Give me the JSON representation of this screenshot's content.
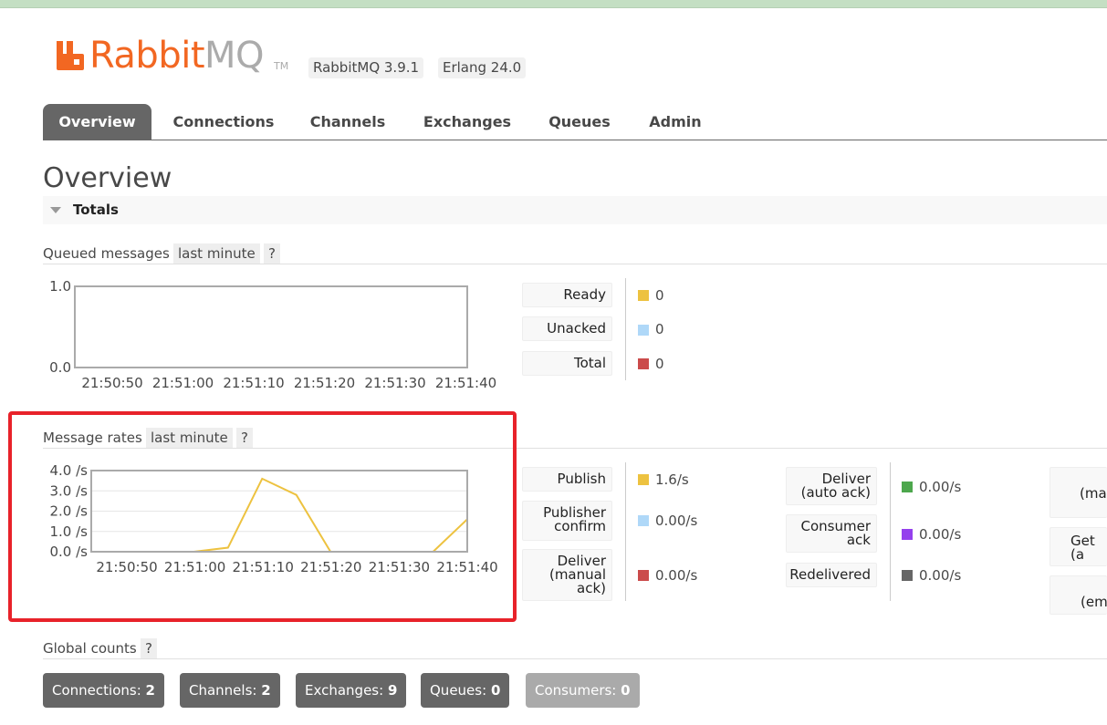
{
  "brand": {
    "name_rabbit": "Rabbit",
    "name_mq": "MQ",
    "tm": "TM",
    "brand_color": "#f26722"
  },
  "header": {
    "version_badges": [
      "RabbitMQ 3.9.1",
      "Erlang 24.0"
    ]
  },
  "nav": {
    "tabs": [
      "Overview",
      "Connections",
      "Channels",
      "Exchanges",
      "Queues",
      "Admin"
    ],
    "active": "Overview"
  },
  "page": {
    "title": "Overview",
    "section_title": "Totals"
  },
  "queued": {
    "label": "Queued messages",
    "range": "last minute",
    "help": "?",
    "legend": [
      {
        "label": "Ready",
        "value": "0",
        "color": "#edc240"
      },
      {
        "label": "Unacked",
        "value": "0",
        "color": "#afd8f8"
      },
      {
        "label": "Total",
        "value": "0",
        "color": "#cb4b4b"
      }
    ]
  },
  "rates": {
    "label": "Message rates",
    "range": "last minute",
    "help": "?",
    "legend_col1": [
      {
        "label": "Publish",
        "value": "1.6/s",
        "color": "#edc240"
      },
      {
        "label": "Publisher confirm",
        "value": "0.00/s",
        "color": "#afd8f8"
      },
      {
        "label": "Deliver (manual ack)",
        "value": "0.00/s",
        "color": "#cb4b4b"
      }
    ],
    "legend_col2": [
      {
        "label": "Deliver (auto ack)",
        "value": "0.00/s",
        "color": "#4da74d"
      },
      {
        "label": "Consumer ack",
        "value": "0.00/s",
        "color": "#9440ed"
      },
      {
        "label": "Redelivered",
        "value": "0.00/s",
        "color": "#666666"
      }
    ],
    "legend_col3_partial": [
      "(ma",
      "Get (a",
      "(em"
    ]
  },
  "global": {
    "label": "Global counts",
    "help": "?",
    "counts": [
      {
        "label": "Connections:",
        "value": "2",
        "enabled": true
      },
      {
        "label": "Channels:",
        "value": "2",
        "enabled": true
      },
      {
        "label": "Exchanges:",
        "value": "9",
        "enabled": true
      },
      {
        "label": "Queues:",
        "value": "0",
        "enabled": true
      },
      {
        "label": "Consumers:",
        "value": "0",
        "enabled": false
      }
    ]
  },
  "chart_data": [
    {
      "type": "line",
      "title": "Queued messages",
      "x": [
        "21:50:50",
        "21:51:00",
        "21:51:10",
        "21:51:20",
        "21:51:30",
        "21:51:40"
      ],
      "ylim": [
        0,
        1
      ],
      "yticks": [
        "0.0",
        "1.0"
      ],
      "series": [
        {
          "name": "Ready",
          "color": "#edc240",
          "values": [
            0,
            0,
            0,
            0,
            0,
            0
          ]
        },
        {
          "name": "Unacked",
          "color": "#afd8f8",
          "values": [
            0,
            0,
            0,
            0,
            0,
            0
          ]
        },
        {
          "name": "Total",
          "color": "#cb4b4b",
          "values": [
            0,
            0,
            0,
            0,
            0,
            0
          ]
        }
      ]
    },
    {
      "type": "line",
      "title": "Message rates",
      "x": [
        "21:50:50",
        "21:51:00",
        "21:51:10",
        "21:51:20",
        "21:51:30",
        "21:51:40"
      ],
      "ylim": [
        0,
        4
      ],
      "yticks": [
        "0.0 /s",
        "1.0 /s",
        "2.0 /s",
        "3.0 /s",
        "4.0 /s"
      ],
      "grid": true,
      "series": [
        {
          "name": "Publish",
          "color": "#edc240",
          "points": [
            [
              0,
              0
            ],
            [
              15,
              0
            ],
            [
              20,
              0.2
            ],
            [
              25,
              3.6
            ],
            [
              30,
              2.8
            ],
            [
              35,
              0
            ],
            [
              40,
              0
            ],
            [
              45,
              0
            ],
            [
              50,
              0
            ],
            [
              55,
              1.6
            ]
          ]
        },
        {
          "name": "Deliver (manual ack)",
          "color": "#9b7fd0",
          "points": [
            [
              0,
              0
            ],
            [
              55,
              0
            ]
          ]
        }
      ]
    }
  ]
}
